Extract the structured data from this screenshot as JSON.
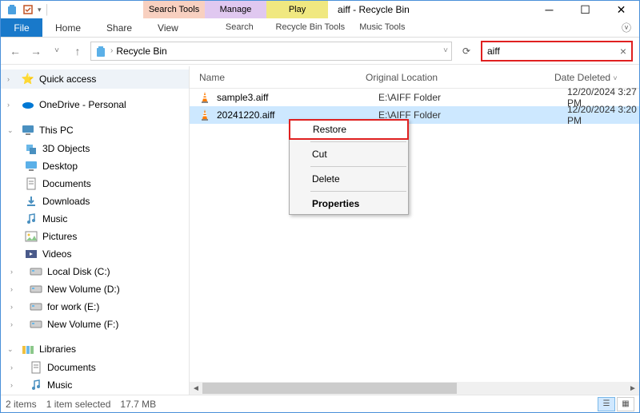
{
  "window": {
    "title": "aiff - Recycle Bin"
  },
  "tool_tabs": {
    "search": "Search Tools",
    "manage": "Manage",
    "play": "Play"
  },
  "lower_tabs": {
    "search": "Search",
    "rbt": "Recycle Bin Tools",
    "music": "Music Tools"
  },
  "ribbon": {
    "file": "File",
    "home": "Home",
    "share": "Share",
    "view": "View"
  },
  "address": {
    "location": "Recycle Bin"
  },
  "search": {
    "query": "aiff"
  },
  "columns": {
    "name": "Name",
    "original_location": "Original Location",
    "date_deleted": "Date Deleted"
  },
  "nav": {
    "quick_access": "Quick access",
    "onedrive": "OneDrive - Personal",
    "this_pc": "This PC",
    "items": [
      "3D Objects",
      "Desktop",
      "Documents",
      "Downloads",
      "Music",
      "Pictures",
      "Videos",
      "Local Disk (C:)",
      "New Volume (D:)",
      "for work (E:)",
      "New Volume (F:)"
    ],
    "libraries": "Libraries",
    "lib_items": [
      "Documents",
      "Music"
    ]
  },
  "files": [
    {
      "name": "sample3.aiff",
      "location": "E:\\AIFF Folder",
      "deleted": "12/20/2024 3:27 PM",
      "selected": false
    },
    {
      "name": "20241220.aiff",
      "location": "E:\\AIFF Folder",
      "deleted": "12/20/2024 3:20 PM",
      "selected": true
    }
  ],
  "context_menu": {
    "restore": "Restore",
    "cut": "Cut",
    "delete": "Delete",
    "properties": "Properties"
  },
  "status": {
    "items": "2 items",
    "selected": "1 item selected",
    "size": "17.7 MB"
  }
}
